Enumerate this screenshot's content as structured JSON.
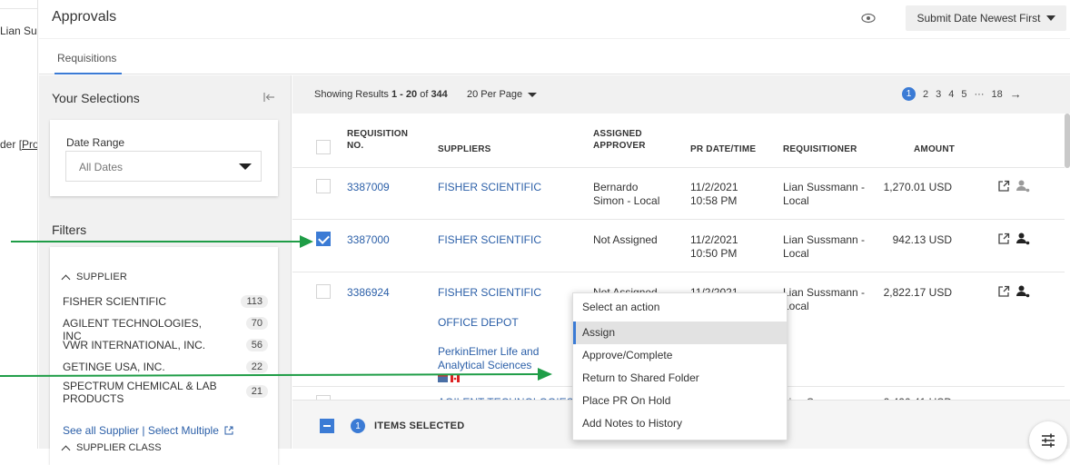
{
  "strip": {
    "text1": "Lian Sus",
    "text2_prefix": "der",
    "text2_link": "[Pro"
  },
  "header": {
    "title": "Approvals",
    "eye_icon": "eye-icon",
    "sort_label": "Submit Date Newest First"
  },
  "tabs": [
    {
      "label": "Requisitions"
    }
  ],
  "left": {
    "your_selections": "Your Selections",
    "date_range_label": "Date Range",
    "date_range_value": "All Dates",
    "filters_title": "Filters",
    "supplier_section": "SUPPLIER",
    "suppliers": [
      {
        "name": "FISHER SCIENTIFIC",
        "count": "113"
      },
      {
        "name": "AGILENT TECHNOLOGIES, INC",
        "count": "70"
      },
      {
        "name": "VWR INTERNATIONAL, INC.",
        "count": "56"
      },
      {
        "name": "GETINGE USA, INC.",
        "count": "22"
      },
      {
        "name": "SPECTRUM CHEMICAL & LAB PRODUCTS",
        "count": "21"
      }
    ],
    "see_all": "See all Supplier | Select Multiple",
    "supplier_class_section": "SUPPLIER CLASS"
  },
  "results": {
    "showing_prefix": "Showing Results ",
    "showing_range": "1 - 20",
    "showing_of": " of ",
    "showing_total": "344",
    "per_page": "20 Per Page",
    "pager": {
      "current": "1",
      "pages": [
        "2",
        "3",
        "4",
        "5"
      ],
      "ellipsis": "···",
      "last": "18",
      "next": "→"
    },
    "columns": {
      "req_no": "REQUISITION NO.",
      "suppliers": "SUPPLIERS",
      "approver": "ASSIGNED APPROVER",
      "date": "PR DATE/TIME",
      "requisitioner": "REQUISITIONER",
      "amount": "AMOUNT"
    },
    "rows": [
      {
        "req": "3387009",
        "supplier": "FISHER SCIENTIFIC",
        "approver": "Bernardo Simon - Local",
        "date": "11/2/2021 10:58 PM",
        "requisitioner": "Lian Sussmann - Local",
        "amount": "1,270.01 USD",
        "checked": false
      },
      {
        "req": "3387000",
        "supplier": "FISHER SCIENTIFIC",
        "approver": "Not Assigned",
        "date": "11/2/2021 10:50 PM",
        "requisitioner": "Lian Sussmann - Local",
        "amount": "942.13 USD",
        "checked": true
      },
      {
        "req": "3386924",
        "supplier": "FISHER SCIENTIFIC",
        "supplier2": "OFFICE DEPOT",
        "supplier3": "PerkinElmer Life and Analytical Sciences",
        "approver": "Not Assigned",
        "date": "11/2/2021",
        "requisitioner": "Lian Sussmann - Local",
        "amount": "2,822.17 USD",
        "checked": false
      },
      {
        "req": "3381530",
        "supplier": "AGILENT TECHNOLOGIES",
        "requisitioner": "Lian Sussmann",
        "amount": "2,420.41 USD",
        "checked": false
      }
    ],
    "items_selected_count": "1",
    "items_selected_label": "ITEMS SELECTED"
  },
  "menu": {
    "header": "Select an action",
    "items": [
      "Assign",
      "Approve/Complete",
      "Return to Shared Folder",
      "Place PR On Hold",
      "Add Notes to History"
    ]
  },
  "colors": {
    "accent": "#3b7bd5",
    "link": "#2b5fa8",
    "arrow": "#1f9d47"
  }
}
